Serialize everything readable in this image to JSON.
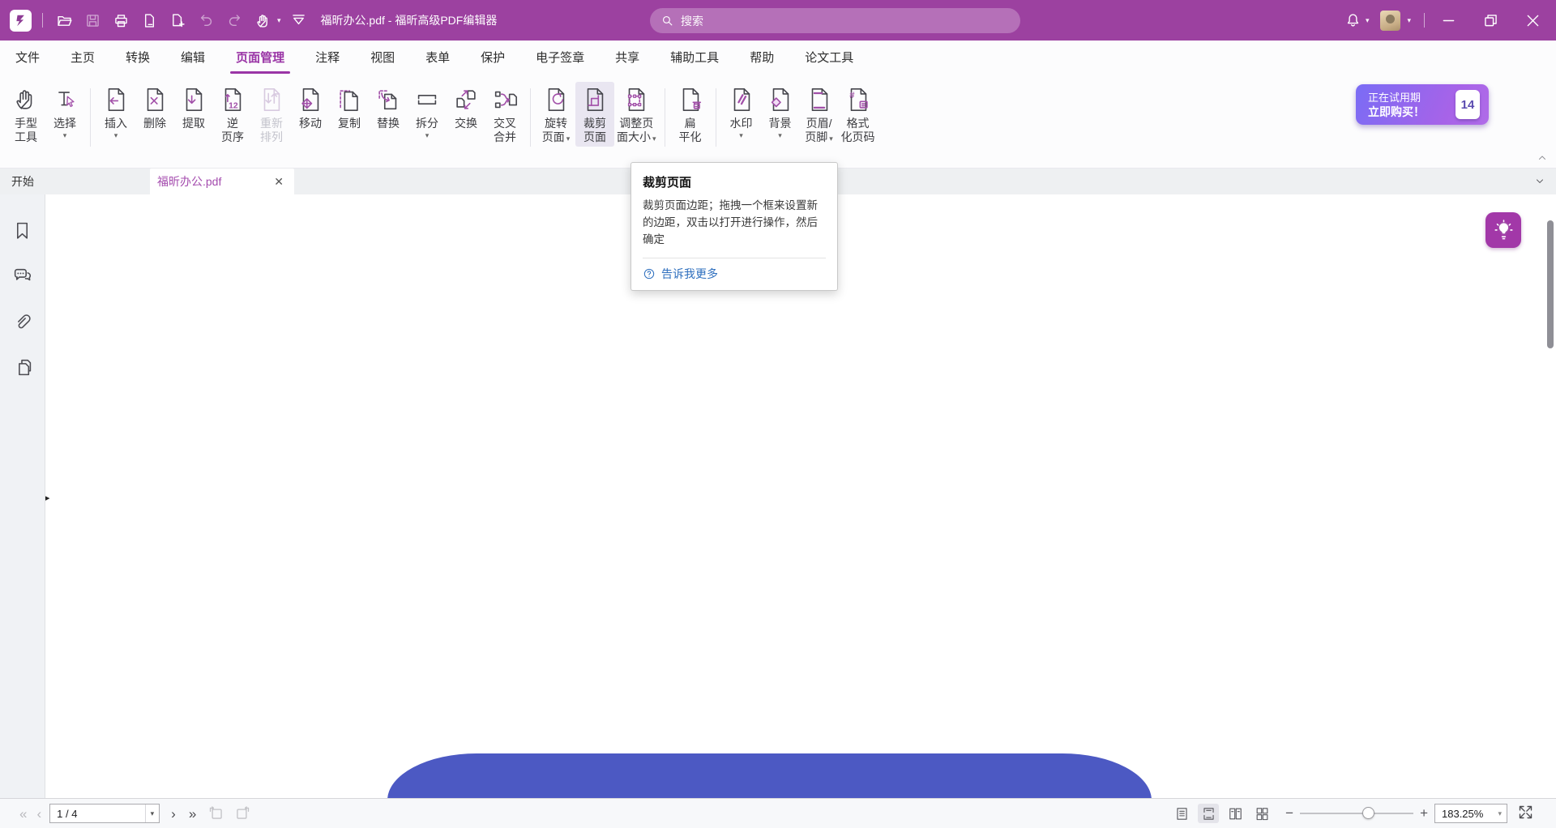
{
  "titlebar": {
    "title": "福昕办公.pdf - 福昕高级PDF编辑器",
    "search_placeholder": "搜索",
    "icons": [
      "app-logo",
      "open-folder",
      "save",
      "print",
      "extract-page",
      "new-page",
      "undo",
      "redo",
      "hand-pointer",
      "quick-skin",
      "bell",
      "avatar",
      "minimize",
      "restore",
      "close"
    ]
  },
  "menubar": {
    "items": [
      {
        "id": "file",
        "label": "文件",
        "active": false
      },
      {
        "id": "home",
        "label": "主页",
        "active": false
      },
      {
        "id": "convert",
        "label": "转换",
        "active": false
      },
      {
        "id": "edit",
        "label": "编辑",
        "active": false
      },
      {
        "id": "page-management",
        "label": "页面管理",
        "active": true
      },
      {
        "id": "comment",
        "label": "注释",
        "active": false
      },
      {
        "id": "view",
        "label": "视图",
        "active": false
      },
      {
        "id": "form",
        "label": "表单",
        "active": false
      },
      {
        "id": "protect",
        "label": "保护",
        "active": false
      },
      {
        "id": "esign",
        "label": "电子签章",
        "active": false
      },
      {
        "id": "share",
        "label": "共享",
        "active": false
      },
      {
        "id": "accessibility",
        "label": "辅助工具",
        "active": false
      },
      {
        "id": "help",
        "label": "帮助",
        "active": false
      },
      {
        "id": "paper-tools",
        "label": "论文工具",
        "active": false
      }
    ]
  },
  "ribbon": {
    "groups": [
      {
        "tools": [
          {
            "icon": "hand",
            "label": "手型\n工具",
            "caret": "none"
          },
          {
            "icon": "select",
            "label": "选择",
            "caret": "below"
          }
        ]
      },
      {
        "tools": [
          {
            "icon": "insert",
            "label": "插入",
            "caret": "below"
          },
          {
            "icon": "delete",
            "label": "删除",
            "caret": "none"
          },
          {
            "icon": "extract",
            "label": "提取",
            "caret": "none"
          },
          {
            "icon": "reverse",
            "label": "逆\n页序",
            "caret": "none"
          },
          {
            "icon": "rearrange",
            "label": "重新\n排列",
            "caret": "none",
            "disabled": true
          },
          {
            "icon": "move",
            "label": "移动",
            "caret": "none"
          },
          {
            "icon": "copy",
            "label": "复制",
            "caret": "none"
          },
          {
            "icon": "replace",
            "label": "替换",
            "caret": "none"
          },
          {
            "icon": "split",
            "label": "拆分",
            "caret": "below"
          },
          {
            "icon": "swap",
            "label": "交换",
            "caret": "none"
          },
          {
            "icon": "crossmerge",
            "label": "交叉\n合并",
            "caret": "none"
          }
        ]
      },
      {
        "tools": [
          {
            "icon": "rotate",
            "label": "旋转\n页面",
            "caret": "inline"
          },
          {
            "icon": "crop",
            "label": "裁剪\n页面",
            "caret": "none",
            "hover": true
          },
          {
            "icon": "resize",
            "label": "调整页\n面大小",
            "caret": "inline"
          }
        ]
      },
      {
        "tools": [
          {
            "icon": "flatten",
            "label": "扁\n平化",
            "caret": "none"
          }
        ]
      },
      {
        "tools": [
          {
            "icon": "watermark",
            "label": "水印",
            "caret": "below"
          },
          {
            "icon": "background",
            "label": "背景",
            "caret": "below"
          },
          {
            "icon": "headerfooter",
            "label": "页眉/\n页脚",
            "caret": "inline"
          },
          {
            "icon": "pagenumber",
            "label": "格式\n化页码",
            "caret": "none"
          }
        ]
      }
    ]
  },
  "trial": {
    "line1": "正在试用期",
    "line2": "立即购买！",
    "days": "14"
  },
  "tabbar": {
    "start": "开始",
    "document": "福昕办公.pdf"
  },
  "sidebar": {
    "icons": [
      "bookmark",
      "comments",
      "attachments",
      "pages"
    ]
  },
  "tooltip": {
    "title": "裁剪页面",
    "body": "裁剪页面边距；拖拽一个框来设置新的边距，双击以打开进行操作，然后确定",
    "link": "告诉我更多"
  },
  "statusbar": {
    "page": "1 / 4",
    "zoom": "183.25%"
  },
  "colors": {
    "titlebar": "#9c41a0",
    "accent": "#a14fa8",
    "doc_shape": "#4c59c3",
    "trial_from": "#7a6cf5",
    "trial_to": "#b06ce8"
  }
}
